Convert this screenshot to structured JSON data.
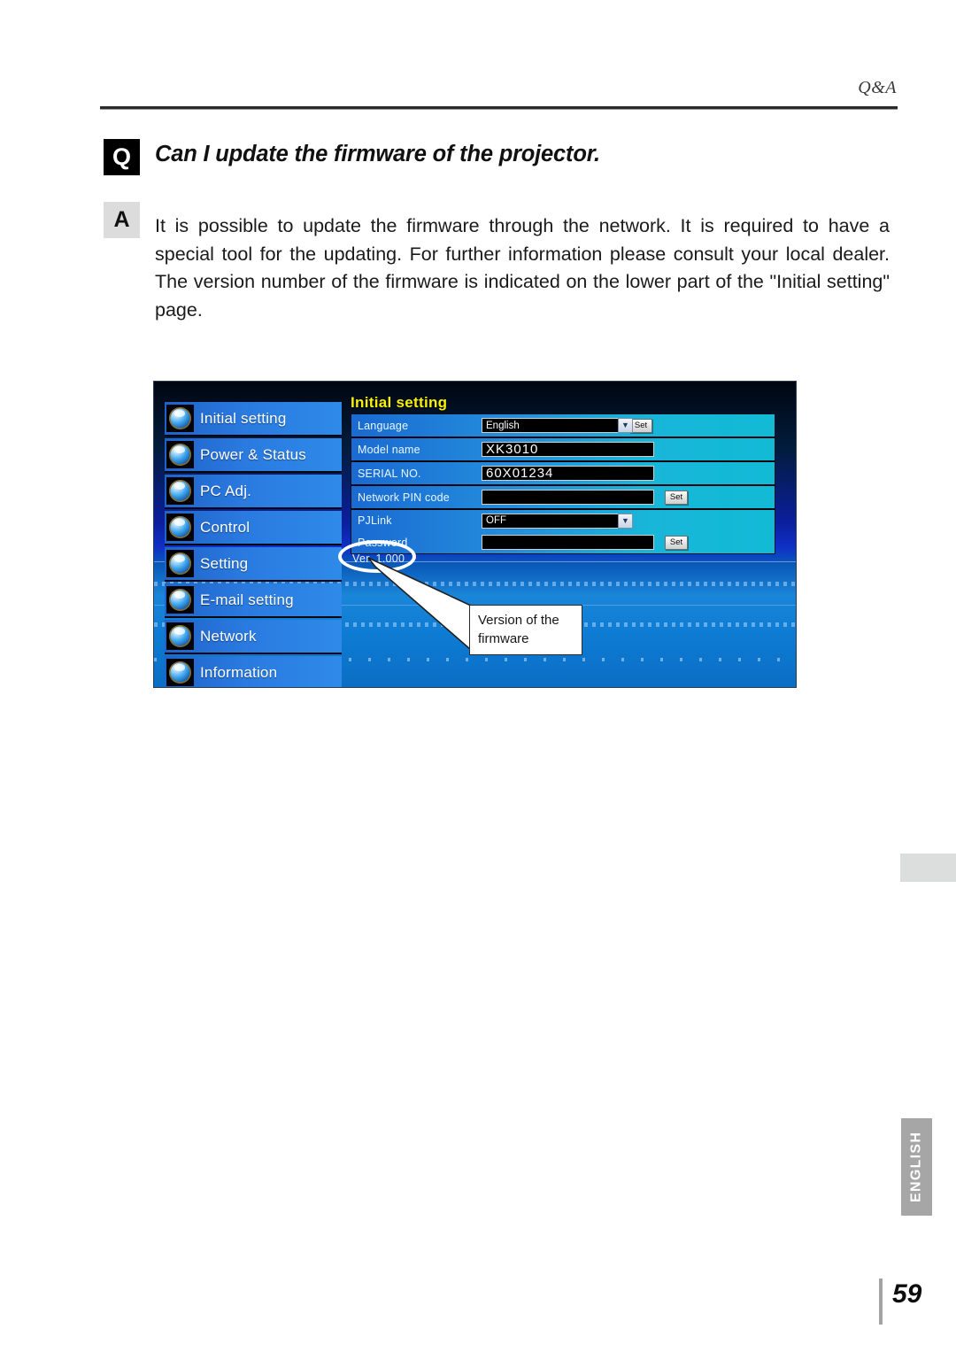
{
  "header": {
    "section_label": "Q&A"
  },
  "qa": {
    "q_badge": "Q",
    "question": "Can I update the firmware of the projector.",
    "a_badge": "A",
    "answer": "It is possible to update the firmware through the network. It is required to have a special tool for the updating. For further information please consult your local dealer. The version number of the firmware is indicated on the lower part of the \"Initial setting\" page."
  },
  "screenshot": {
    "sidebar": {
      "items": [
        {
          "label": "Initial setting",
          "icon": "initial-setting-orb-icon"
        },
        {
          "label": "Power & Status",
          "icon": "power-status-orb-icon"
        },
        {
          "label": "PC Adj.",
          "icon": "pc-adj-orb-icon"
        },
        {
          "label": "Control",
          "icon": "control-orb-icon"
        },
        {
          "label": "Setting",
          "icon": "setting-orb-icon"
        },
        {
          "label": "E-mail setting",
          "icon": "email-setting-orb-icon"
        },
        {
          "label": "Network",
          "icon": "network-orb-icon"
        },
        {
          "label": "Information",
          "icon": "information-orb-icon"
        }
      ]
    },
    "panel": {
      "title": "Initial setting",
      "rows": [
        {
          "label": "Language",
          "value": "English",
          "control": "select",
          "button": "Set"
        },
        {
          "label": "Model name",
          "value": "XK3010",
          "control": "text",
          "button": ""
        },
        {
          "label": "SERIAL NO.",
          "value": "60X01234",
          "control": "text",
          "button": ""
        },
        {
          "label": "Network PIN code",
          "value": "",
          "control": "text",
          "button": "Set"
        },
        {
          "label": "PJLink",
          "value": "OFF",
          "control": "select",
          "button": ""
        },
        {
          "label": "Password",
          "value": "",
          "control": "text",
          "button": "Set"
        }
      ],
      "version": "Ver. 1.000",
      "dropdown_arrow": "chevron-down-icon"
    },
    "annotation": {
      "callout_line1": "Version of the",
      "callout_line2": "firmware"
    }
  },
  "footer": {
    "language_tab": "ENGLISH",
    "page_number": "59"
  },
  "colors": {
    "panel_title": "#f8f000",
    "nav_blue": "#2a7ae0",
    "badge_q_bg": "#000000",
    "badge_a_bg": "#dcdcdc",
    "language_tab_bg": "#a6a6a6"
  }
}
